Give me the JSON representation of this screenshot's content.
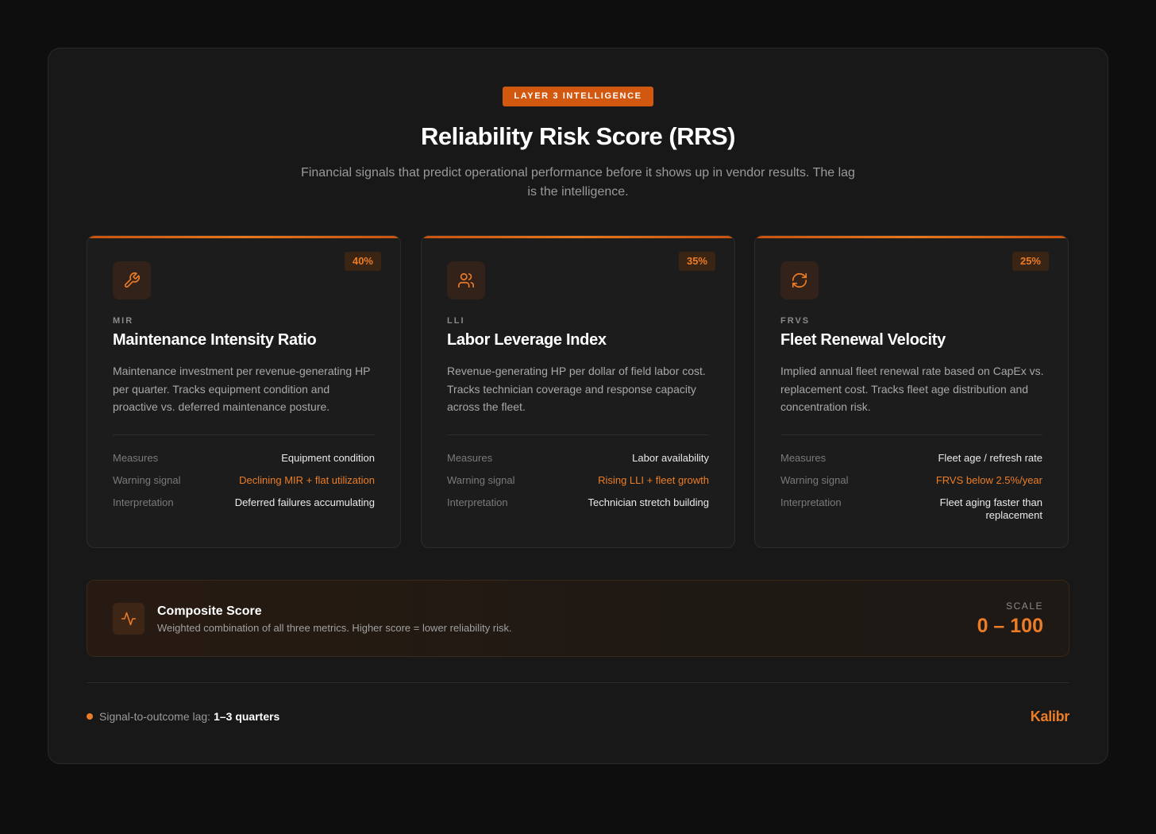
{
  "header": {
    "badge": "LAYER 3 INTELLIGENCE",
    "title": "Reliability Risk Score (RRS)",
    "subtitle": "Financial signals that predict operational performance before it shows up in vendor results. The lag is the intelligence."
  },
  "cards": [
    {
      "weight": "40%",
      "icon": "wrench-icon",
      "abbr": "MIR",
      "title": "Maintenance Intensity Ratio",
      "description": "Maintenance investment per revenue-generating HP per quarter. Tracks equipment condition and proactive vs. deferred maintenance posture.",
      "rows": [
        {
          "key": "Measures",
          "value": "Equipment condition"
        },
        {
          "key": "Warning signal",
          "value": "Declining MIR + flat utilization"
        },
        {
          "key": "Interpretation",
          "value": "Deferred failures accumulating"
        }
      ]
    },
    {
      "weight": "35%",
      "icon": "users-icon",
      "abbr": "LLI",
      "title": "Labor Leverage Index",
      "description": "Revenue-generating HP per dollar of field labor cost. Tracks technician coverage and response capacity across the fleet.",
      "rows": [
        {
          "key": "Measures",
          "value": "Labor availability"
        },
        {
          "key": "Warning signal",
          "value": "Rising LLI + fleet growth"
        },
        {
          "key": "Interpretation",
          "value": "Technician stretch building"
        }
      ]
    },
    {
      "weight": "25%",
      "icon": "refresh-icon",
      "abbr": "FRVS",
      "title": "Fleet Renewal Velocity",
      "description": "Implied annual fleet renewal rate based on CapEx vs. replacement cost. Tracks fleet age distribution and concentration risk.",
      "rows": [
        {
          "key": "Measures",
          "value": "Fleet age / refresh rate"
        },
        {
          "key": "Warning signal",
          "value": "FRVS below 2.5%/year"
        },
        {
          "key": "Interpretation",
          "value": "Fleet aging faster than replacement"
        }
      ]
    }
  ],
  "composite": {
    "icon": "activity-icon",
    "title": "Composite Score",
    "description": "Weighted combination of all three metrics. Higher score = lower reliability risk.",
    "scale_label": "SCALE",
    "scale_value": "0 – 100"
  },
  "footer": {
    "lag_label": "Signal-to-outcome lag:",
    "lag_value": "1–3 quarters",
    "brand": "Kalibr"
  },
  "colors": {
    "accent": "#ec7d26",
    "badge": "#d3580f",
    "background": "#0e0e0e",
    "panel": "#181818"
  }
}
